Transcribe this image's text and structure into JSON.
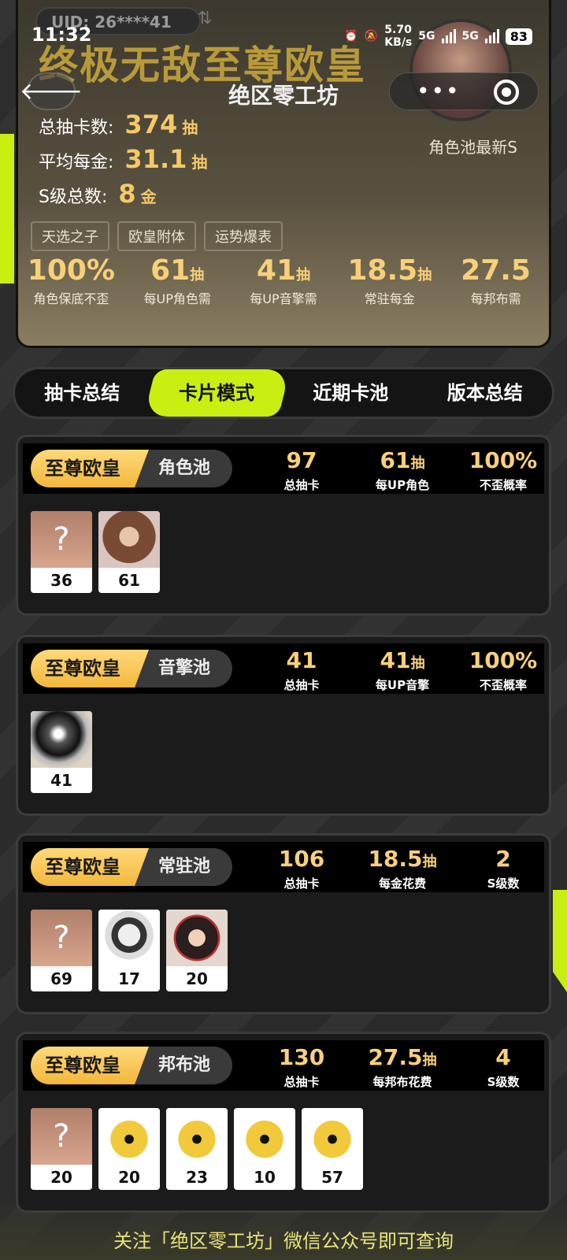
{
  "status": {
    "time": "11:32",
    "net_speed": "5.70",
    "net_unit": "KB/s",
    "sig1": "5G",
    "sig2": "5G",
    "battery": "83"
  },
  "titlebar": {
    "title": "绝区零工坊",
    "more": "•••"
  },
  "summary": {
    "uid": "UID: 26****41",
    "uid_swap": "⇅",
    "title": "终极无敌至尊欧皇",
    "total_label": "总抽卡数:",
    "total_value": "374",
    "total_unit": "抽",
    "avg_label": "平均每金:",
    "avg_value": "31.1",
    "avg_unit": "抽",
    "s_label": "S级总数:",
    "s_value": "8",
    "s_unit": "金",
    "pool_latest": "角色池最新S",
    "tags": [
      "天选之子",
      "欧皇附体",
      "运势爆表"
    ],
    "stats": [
      {
        "value": "100%",
        "unit": "",
        "label": "角色保底不歪"
      },
      {
        "value": "61",
        "unit": "抽",
        "label": "每UP角色需"
      },
      {
        "value": "41",
        "unit": "抽",
        "label": "每UP音擎需"
      },
      {
        "value": "18.5",
        "unit": "抽",
        "label": "常驻每金"
      },
      {
        "value": "27.5",
        "unit": "",
        "label": "每邦布需"
      }
    ]
  },
  "tabs": [
    "抽卡总结",
    "卡片模式",
    "近期卡池",
    "版本总结"
  ],
  "pools": [
    {
      "rank": "至尊欧皇",
      "name": "角色池",
      "s1v": "97",
      "s1u": "",
      "s1l": "总抽卡",
      "s2v": "61",
      "s2u": "抽",
      "s2l": "每UP角色",
      "s3v": "100%",
      "s3u": "",
      "s3l": "不歪概率",
      "cards": [
        {
          "art": "unknown",
          "n": "36"
        },
        {
          "art": "girl",
          "n": "61"
        }
      ]
    },
    {
      "rank": "至尊欧皇",
      "name": "音擎池",
      "s1v": "41",
      "s1u": "",
      "s1l": "总抽卡",
      "s2v": "41",
      "s2u": "抽",
      "s2l": "每UP音擎",
      "s3v": "100%",
      "s3u": "",
      "s3l": "不歪概率",
      "cards": [
        {
          "art": "orb",
          "n": "41"
        }
      ]
    },
    {
      "rank": "至尊欧皇",
      "name": "常驻池",
      "s1v": "106",
      "s1u": "",
      "s1l": "总抽卡",
      "s2v": "18.5",
      "s2u": "抽",
      "s2l": "每金花费",
      "s3v": "2",
      "s3u": "",
      "s3l": "S级数",
      "cards": [
        {
          "art": "unknown",
          "n": "69"
        },
        {
          "art": "wolf",
          "n": "17"
        },
        {
          "art": "girl2",
          "n": "20"
        }
      ]
    },
    {
      "rank": "至尊欧皇",
      "name": "邦布池",
      "s1v": "130",
      "s1u": "",
      "s1l": "总抽卡",
      "s2v": "27.5",
      "s2u": "抽",
      "s2l": "每邦布花费",
      "s3v": "4",
      "s3u": "",
      "s3l": "S级数",
      "cards": [
        {
          "art": "unknown",
          "n": "20"
        },
        {
          "art": "bangboo",
          "n": "20"
        },
        {
          "art": "bangboo",
          "n": "23"
        },
        {
          "art": "bangboo",
          "n": "10"
        },
        {
          "art": "bangboo",
          "n": "57"
        }
      ]
    }
  ],
  "footer": "关注「绝区零工坊」微信公众号即可查询"
}
